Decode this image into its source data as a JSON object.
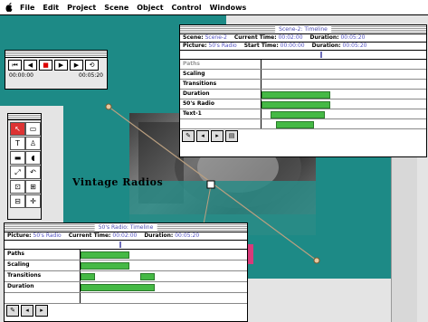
{
  "menubar": {
    "items": [
      "File",
      "Edit",
      "Project",
      "Scene",
      "Object",
      "Control",
      "Windows"
    ]
  },
  "controller": {
    "time_start": "00:00:00",
    "time_end": "00:05:20"
  },
  "stage": {
    "title_text": "Vintage Radios",
    "colors": {
      "teal": "#1d8a86",
      "bar_green": "#45b945",
      "pink": "#d83a7a"
    }
  },
  "timeline_scene": {
    "title": "Scene-2: Timeline",
    "scene_label": "Scene:",
    "scene_value": "Scene-2",
    "current_label": "Current Time:",
    "current_value": "00:02:00",
    "duration_label": "Duration:",
    "duration_value": "00:05:20",
    "picture_label": "Picture:",
    "picture_value": "50's Radio",
    "start_label": "Start Time:",
    "start_value": "00:00:00",
    "duration2_label": "Duration:",
    "duration2_value": "00:05:20",
    "rows": [
      "Paths",
      "Scaling",
      "Transitions",
      "Duration",
      "50's Radio",
      "Text-1"
    ]
  },
  "timeline_object": {
    "title": "50's Radio: Timeline",
    "picture_label": "Picture:",
    "picture_value": "50's Radio",
    "current_label": "Current Time:",
    "current_value": "00:02:00",
    "duration_label": "Duration:",
    "duration_value": "00:05:20",
    "rows": [
      "Paths",
      "Scaling",
      "Transitions",
      "Duration"
    ]
  }
}
